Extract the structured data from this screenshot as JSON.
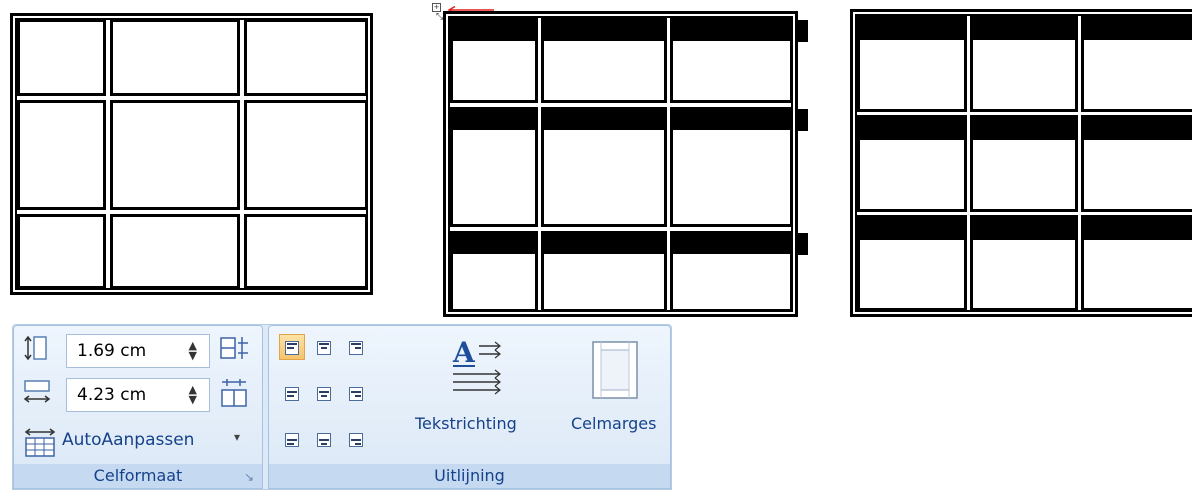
{
  "ribbon": {
    "height_value": "1.69 cm",
    "width_value": "4.23 cm",
    "autofit_label": "AutoAanpassen",
    "autofit_arrow": "▾",
    "group_celformaat": "Celformaat",
    "group_uitlijning": "Uitlijning",
    "text_direction_label": "Tekstrichting",
    "cell_margins_label": "Celmarges",
    "text_direction_glyph": "A",
    "spin_arrows": "▲▼",
    "dialog_launcher": "↘",
    "icons": {
      "row_height": "row-height-icon",
      "column_width": "column-width-icon",
      "distribute_rows": "distribute-rows-icon",
      "distribute_columns": "distribute-columns-icon",
      "autofit": "autofit-icon",
      "text_direction": "text-direction-icon",
      "cell_margins": "cell-margins-icon"
    },
    "alignment_buttons": [
      "align-top-left",
      "align-top-center",
      "align-top-right",
      "align-middle-left",
      "align-middle-center",
      "align-middle-right",
      "align-bottom-left",
      "align-bottom-center",
      "align-bottom-right"
    ],
    "selected_alignment": "align-top-left"
  },
  "tables": {
    "count": 3,
    "rows": 3,
    "columns": 3
  },
  "colors": {
    "ribbon_label": "#15428b",
    "selected_button": "#f8c36a",
    "arrow": "#e02020"
  }
}
